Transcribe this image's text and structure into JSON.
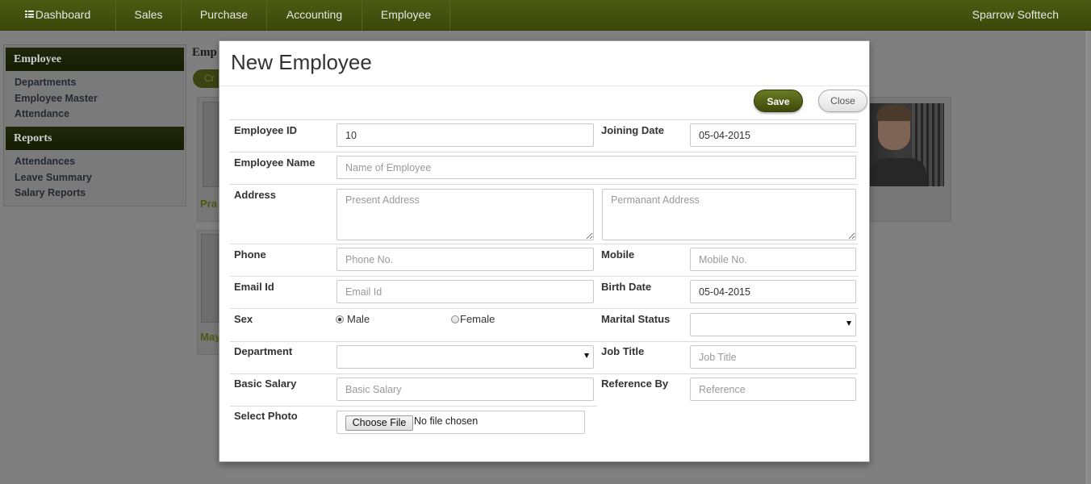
{
  "nav": {
    "items": [
      "Dashboard",
      "Sales",
      "Purchase",
      "Accounting",
      "Employee"
    ],
    "brand": "Sparrow Softtech"
  },
  "sidebar": {
    "sections": [
      {
        "title": "Employee",
        "links": [
          "Departments",
          "Employee Master",
          "Attendance"
        ]
      },
      {
        "title": "Reports",
        "links": [
          "Attendances",
          "Leave Summary",
          "Salary Reports"
        ]
      }
    ]
  },
  "background": {
    "title_partial": "Emp",
    "create_partial": "Cr",
    "cards": [
      "Pra",
      "May"
    ]
  },
  "modal": {
    "title": "New Employee",
    "save_label": "Save",
    "close_label": "Close",
    "labels": {
      "employee_id": "Employee ID",
      "joining_date": "Joining Date",
      "employee_name": "Employee Name",
      "address": "Address",
      "phone": "Phone",
      "mobile": "Mobile",
      "email": "Email Id",
      "birth_date": "Birth Date",
      "sex": "Sex",
      "marital_status": "Marital Status",
      "department": "Department",
      "job_title": "Job Title",
      "basic_salary": "Basic Salary",
      "reference_by": "Reference By",
      "select_photo": "Select Photo"
    },
    "values": {
      "employee_id": "10",
      "joining_date": "05-04-2015",
      "birth_date": "05-04-2015",
      "employee_name": "",
      "marital_status": "",
      "department": ""
    },
    "placeholders": {
      "employee_name": "Name of Employee",
      "present_address": "Present Address",
      "permanent_address": "Permanant Address",
      "phone": "Phone No.",
      "mobile": "Mobile No.",
      "email": "Email Id",
      "job_title": "Job Title",
      "basic_salary": "Basic Salary",
      "reference": "Reference"
    },
    "sex_options": [
      "Male",
      "Female"
    ],
    "sex_selected": "Male",
    "file": {
      "button": "Choose File",
      "status": "No file chosen"
    }
  }
}
